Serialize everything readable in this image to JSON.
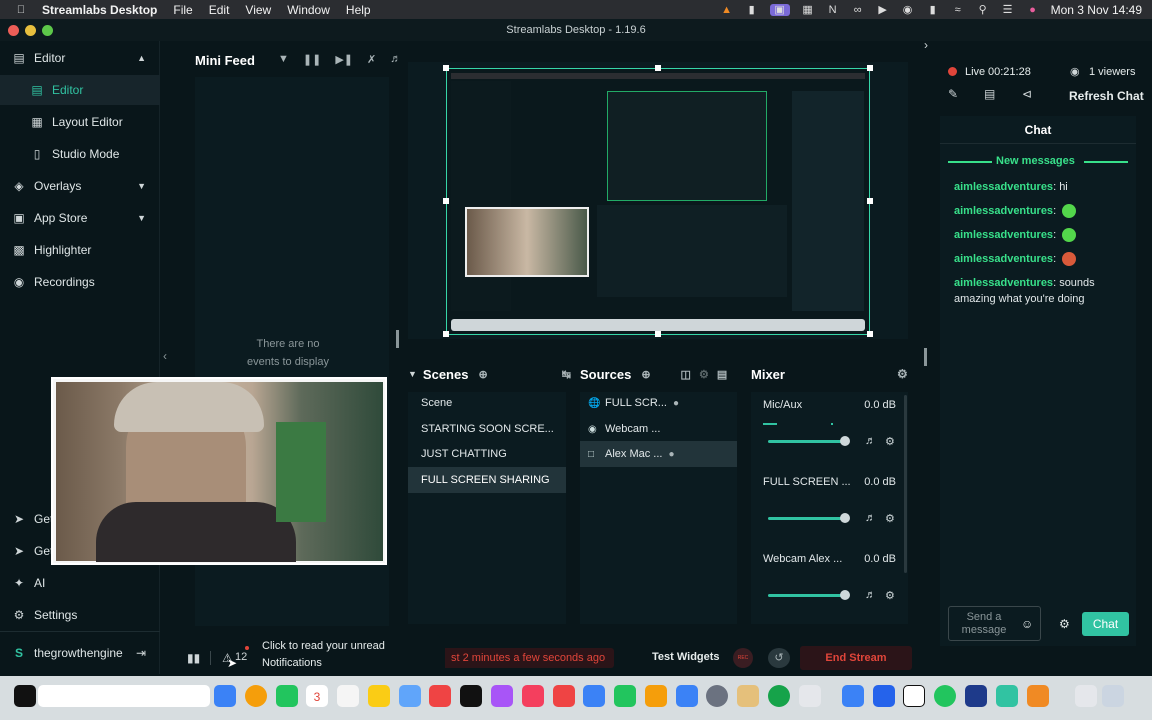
{
  "menubar": {
    "app_name": "Streamlabs Desktop",
    "items": [
      "File",
      "Edit",
      "View",
      "Window",
      "Help"
    ],
    "datetime": "Mon 3 Nov  14:49"
  },
  "window": {
    "title": "Streamlabs Desktop - 1.19.6"
  },
  "sidebar": {
    "items": [
      {
        "label": "Editor",
        "icon": "editor-icon",
        "expandable": true
      },
      {
        "label": "Editor",
        "icon": "editor-icon",
        "active": true
      },
      {
        "label": "Layout Editor",
        "icon": "layout-icon"
      },
      {
        "label": "Studio Mode",
        "icon": "studio-mode-icon"
      },
      {
        "label": "Overlays",
        "icon": "overlays-icon",
        "expandable": true
      },
      {
        "label": "App Store",
        "icon": "store-icon",
        "expandable": true
      },
      {
        "label": "Highlighter",
        "icon": "highlighter-icon"
      },
      {
        "label": "Recordings",
        "icon": "recordings-icon"
      }
    ],
    "bottom_items": [
      {
        "label": "Get",
        "icon": "get-icon"
      },
      {
        "label": "Get",
        "icon": "get-icon"
      },
      {
        "label": "AI",
        "icon": "ai-icon"
      },
      {
        "label": "Settings",
        "icon": "gear-icon"
      }
    ],
    "account": "thegrowthengine"
  },
  "minifeed": {
    "title": "Mini Feed",
    "empty_text_line1": "There are no",
    "empty_text_line2": "events to display"
  },
  "scenes": {
    "title": "Scenes",
    "items": [
      "Scene",
      "STARTING SOON SCRE...",
      "JUST CHATTING",
      "FULL SCREEN SHARING"
    ],
    "selected_index": 3
  },
  "sources": {
    "title": "Sources",
    "items": [
      {
        "label": "FULL SCR...",
        "icon": "globe-icon",
        "locked": true
      },
      {
        "label": "Webcam ...",
        "icon": "webcam-icon",
        "locked": false
      },
      {
        "label": "Alex Mac ...",
        "icon": "display-capture-icon",
        "locked": true
      }
    ],
    "selected_index": 2
  },
  "mixer": {
    "title": "Mixer",
    "channels": [
      {
        "name": "Mic/Aux",
        "db": "0.0 dB"
      },
      {
        "name": "FULL SCREEN ...",
        "db": "0.0 dB"
      },
      {
        "name": "Webcam Alex ...",
        "db": "0.0 dB"
      }
    ]
  },
  "bottombar": {
    "notification_count": "12",
    "notification_tooltip_line1": "Click to read your unread",
    "notification_tooltip_line2": "Notifications",
    "stream_status": "st 2 minutes a few seconds ago",
    "test_widgets": "Test Widgets",
    "rec_label": "REC",
    "end_stream": "End Stream"
  },
  "livebar": {
    "live_label": "Live",
    "timer": "00:21:28",
    "viewers": "1 viewers",
    "refresh_chat": "Refresh Chat"
  },
  "chat": {
    "title": "Chat",
    "new_messages": "New messages",
    "messages": [
      {
        "user": "aimlessadventures",
        "text": "hi",
        "emote": false
      },
      {
        "user": "aimlessadventures",
        "text": "",
        "emote": true
      },
      {
        "user": "aimlessadventures",
        "text": "",
        "emote": true
      },
      {
        "user": "aimlessadventures",
        "text": "",
        "emote": true
      },
      {
        "user": "aimlessadventures",
        "text": "sounds amazing what you're doing",
        "emote": false
      }
    ],
    "input_placeholder": "Send a message",
    "send_label": "Chat"
  },
  "dock": {
    "calendar_day": "3"
  },
  "colors": {
    "accent": "#31c3a2",
    "live_red": "#e0453a",
    "chat_user": "#38e08a",
    "bg": "#09161a",
    "panel": "#0b1b20"
  }
}
